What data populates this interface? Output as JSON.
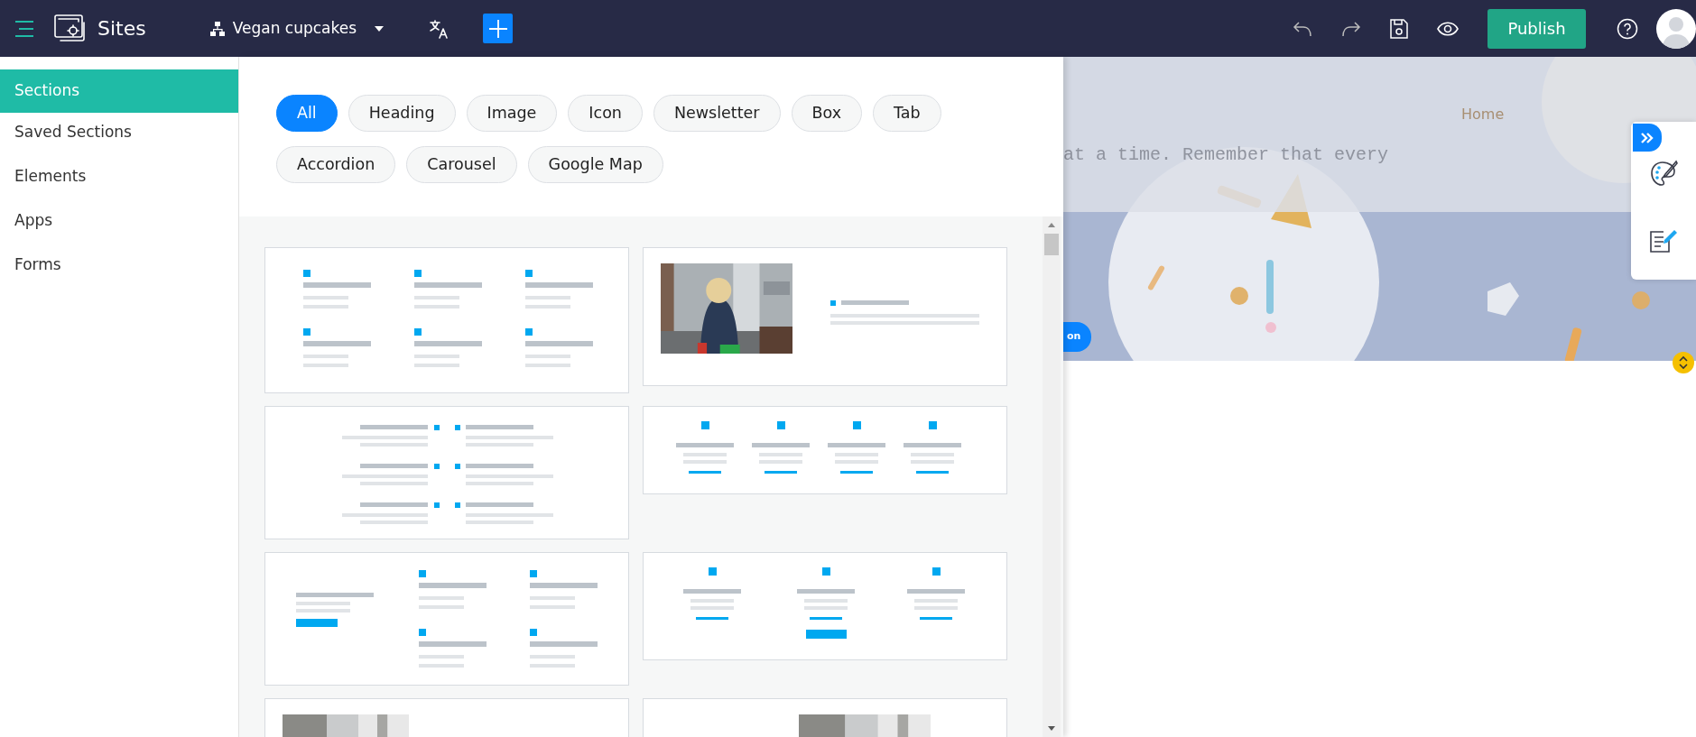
{
  "topbar": {
    "app_name": "Sites",
    "site_name": "Vegan cupcakes",
    "publish_label": "Publish"
  },
  "sidebar": {
    "items": [
      {
        "label": "Sections",
        "selected": true
      },
      {
        "label": "Saved Sections",
        "selected": false
      },
      {
        "label": "Elements",
        "selected": false
      },
      {
        "label": "Apps",
        "selected": false
      },
      {
        "label": "Forms",
        "selected": false
      }
    ]
  },
  "filters": [
    {
      "label": "All",
      "selected": true
    },
    {
      "label": "Heading",
      "selected": false
    },
    {
      "label": "Image",
      "selected": false
    },
    {
      "label": "Icon",
      "selected": false
    },
    {
      "label": "Newsletter",
      "selected": false
    },
    {
      "label": "Box",
      "selected": false
    },
    {
      "label": "Tab",
      "selected": false
    },
    {
      "label": "Accordion",
      "selected": false
    },
    {
      "label": "Carousel",
      "selected": false
    },
    {
      "label": "Google Map",
      "selected": false
    }
  ],
  "templates": [
    {
      "kind": "icon-grid"
    },
    {
      "kind": "image-text"
    },
    {
      "kind": "timeline"
    },
    {
      "kind": "four-columns"
    },
    {
      "kind": "split-features"
    },
    {
      "kind": "three-columns"
    },
    {
      "kind": "picture-left"
    },
    {
      "kind": "picture-right"
    }
  ],
  "preview": {
    "header_text": "at a time. Remember that every",
    "nav_link": "Home",
    "button_label": "on"
  }
}
